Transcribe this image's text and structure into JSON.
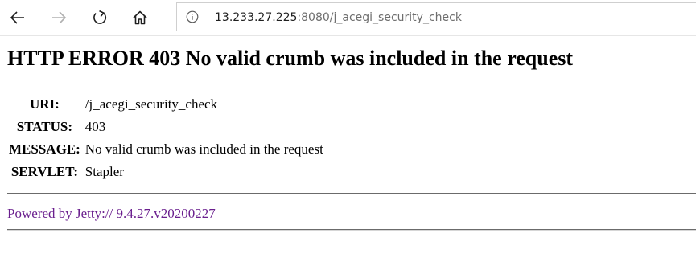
{
  "browser": {
    "back_icon": "arrow-left-icon",
    "forward_icon": "arrow-right-icon",
    "refresh_icon": "refresh-icon",
    "home_icon": "home-icon",
    "site_info_icon": "info-icon",
    "url_host": "13.233.27.225",
    "url_rest": ":8080/j_acegi_security_check"
  },
  "page": {
    "title": "HTTP ERROR 403 No valid crumb was included in the request",
    "rows": [
      {
        "label": "URI:",
        "value": "/j_acegi_security_check"
      },
      {
        "label": "STATUS:",
        "value": "403"
      },
      {
        "label": "MESSAGE:",
        "value": "No valid crumb was included in the request"
      },
      {
        "label": "SERVLET:",
        "value": "Stapler"
      }
    ],
    "powered_by": "Powered by Jetty:// 9.4.27.v20200227"
  },
  "colors": {
    "link_visited": "#6a1f8e",
    "url_host": "#1f1f1f",
    "url_rest": "#6e6e6e",
    "icon_active": "#1f1f1f",
    "icon_disabled": "#b0b0b0"
  }
}
